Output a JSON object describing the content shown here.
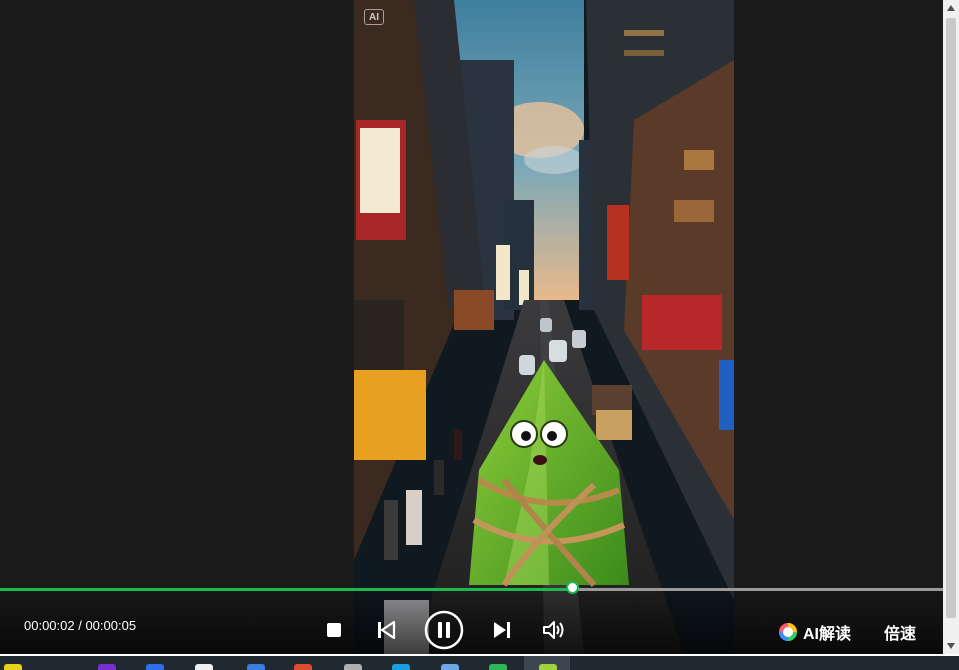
{
  "video": {
    "ai_badge": "AI"
  },
  "playback": {
    "current_time": "00:00:02",
    "separator": " / ",
    "duration": "00:00:05",
    "progress_fraction": 0.61
  },
  "controls": {
    "ai_read_label": "AI解读",
    "speed_label": "倍速",
    "icons": [
      "stop-icon",
      "skip-previous-icon",
      "pause-icon",
      "skip-next-icon",
      "volume-icon"
    ]
  },
  "colors": {
    "accent": "#1fb84f",
    "track": "#9a9a9a",
    "background": "#1b1b1b"
  },
  "taskbar": {
    "icons": [
      {
        "color": "#e8d21a"
      },
      {
        "color": "#7a2fd0"
      },
      {
        "color": "#2f6fe8"
      },
      {
        "color": "#eeeeee"
      },
      {
        "color": "#3d7de0"
      },
      {
        "color": "#e04a30"
      },
      {
        "color": "#b0b0b0"
      },
      {
        "color": "#1aa0e0"
      },
      {
        "color": "#6fa8e8"
      },
      {
        "color": "#2fb85a"
      },
      {
        "color": "#9fd43a"
      }
    ]
  }
}
